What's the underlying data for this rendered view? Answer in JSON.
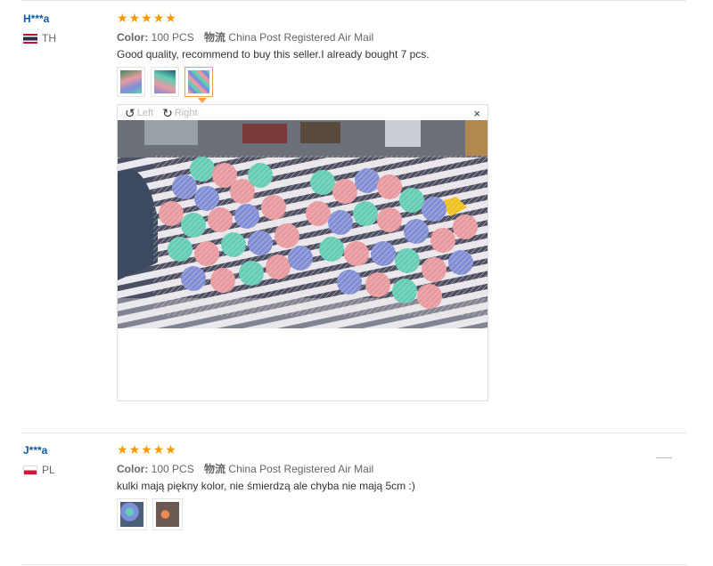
{
  "reviews": [
    {
      "user": "H***a",
      "country": "TH",
      "stars": [
        "★",
        "★",
        "★",
        "★",
        "★"
      ],
      "color_label": "Color:",
      "color_value": "100 PCS",
      "shipping_label": "物流",
      "shipping_value": "China Post Registered Air Mail",
      "text": "Good quality, recommend to buy this seller.I already bought 7 pcs."
    },
    {
      "user": "J***a",
      "country": "PL",
      "stars": [
        "★",
        "★",
        "★",
        "★",
        "★"
      ],
      "color_label": "Color:",
      "color_value": "100 PCS",
      "shipping_label": "物流",
      "shipping_value": "China Post Registered Air Mail",
      "text": "kulki mają piękny kolor, nie śmierdzą ale chyba nie mają 5cm :)"
    }
  ],
  "viewer": {
    "rotate_left": "Left",
    "rotate_right": "Right",
    "close": "×"
  },
  "colors": {
    "username": "#0e5aa7",
    "star": "#f59b00",
    "active_thumb": "#f0a050",
    "ball_pink": "#e89aa0",
    "ball_teal": "#5fcfb5",
    "ball_blue": "#7f8ed8"
  },
  "icons": [
    "rotate-left-icon",
    "rotate-right-icon",
    "close-icon",
    "star-icon",
    "flag-icon"
  ]
}
